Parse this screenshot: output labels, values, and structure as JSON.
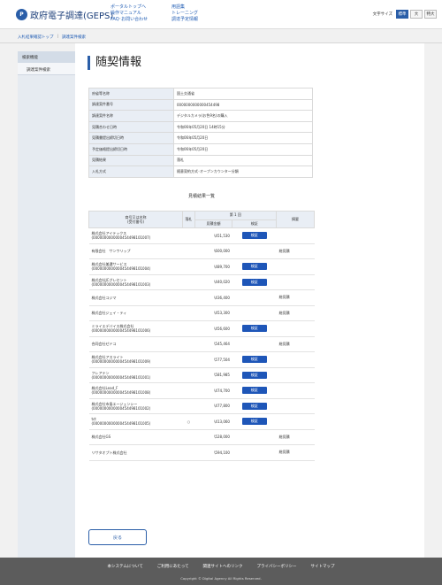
{
  "header": {
    "logo_mark": "P",
    "logo_text": "政府電子調達(GEPS)",
    "nav_col1": [
      "ポータルトップへ",
      "操作マニュアル",
      "FAQ･お問い合わせ"
    ],
    "nav_col2": [
      "用語集",
      "トレーニング",
      "調達予定情報"
    ],
    "fontsize_label": "文字サイズ",
    "fontsize_options": [
      "標準",
      "大",
      "特大"
    ]
  },
  "breadcrumb": [
    "入札結果確認トップ",
    "調達案件検索"
  ],
  "sidebar": {
    "heading": "検索機能",
    "items": [
      "調達案件検索"
    ]
  },
  "page_title": "随契情報",
  "info_rows": [
    {
      "label": "府省等名称",
      "value": "国土交通省"
    },
    {
      "label": "調達案件番号",
      "value": "0000000000000454498"
    },
    {
      "label": "調達案件名称",
      "value": "デジタルカメラ(お色9名)の購入"
    },
    {
      "label": "見積合わせ日時",
      "value": "令和06年05月20日 14時15分"
    },
    {
      "label": "見積書提出締切日時",
      "value": "令和06年05月20日"
    },
    {
      "label": "予定価格提出締切日時",
      "value": "令和06年05月20日"
    },
    {
      "label": "見積結果",
      "value": "落札"
    },
    {
      "label": "入札方式",
      "value": "随意契約方式･オープンカウンター分類"
    }
  ],
  "results_title": "見積結果一覧",
  "results_header": {
    "name": "商号又は名称\n(受付番号)",
    "mark": "落札",
    "round": "第 1 回",
    "amount": "見積金額",
    "check": "検証",
    "note": "摘要"
  },
  "results": [
    {
      "name": "株式会社アイテックス",
      "id": "(0000000000000454498101007)",
      "mark": "",
      "amount": "\\451,530",
      "check": "検証",
      "note": ""
    },
    {
      "name": "有限会社　サンワリップ",
      "id": "",
      "mark": "",
      "amount": "\\600,000",
      "check": "",
      "note": "総見積"
    },
    {
      "name": "株式会社美濃サービス",
      "id": "(0000000000000454498101004)",
      "mark": "",
      "amount": "\\489,700",
      "check": "検証",
      "note": ""
    },
    {
      "name": "株式会社JCグレセント",
      "id": "(0000000000000454498101003)",
      "mark": "",
      "amount": "\\440,020",
      "check": "検証",
      "note": ""
    },
    {
      "name": "株式会社コジマ",
      "id": "",
      "mark": "",
      "amount": "\\436,400",
      "check": "",
      "note": "総見積"
    },
    {
      "name": "株式会社ジェイ・ティ",
      "id": "",
      "mark": "",
      "amount": "\\453,300",
      "check": "",
      "note": "総見積"
    },
    {
      "name": "ミライエデバイス株式会社",
      "id": "(0000000000000454498101006)",
      "mark": "",
      "amount": "\\456,600",
      "check": "検証",
      "note": ""
    },
    {
      "name": "合同会社ゼドコ",
      "id": "",
      "mark": "",
      "amount": "\\545,464",
      "check": "",
      "note": "総見積"
    },
    {
      "name": "株式会社アスライト",
      "id": "(0000000000000454498101009)",
      "mark": "",
      "amount": "\\577,504",
      "check": "検証",
      "note": ""
    },
    {
      "name": "フレアテン",
      "id": "(0000000000000454498101001)",
      "mark": "",
      "amount": "\\581,985",
      "check": "検証",
      "note": ""
    },
    {
      "name": "株式会社Lead_F",
      "id": "(0000000000000454498101008)",
      "mark": "",
      "amount": "\\474,700",
      "check": "検証",
      "note": ""
    },
    {
      "name": "株式会社市島エージェンシー",
      "id": "(0000000000000454498101002)",
      "mark": "",
      "amount": "\\477,800",
      "check": "検証",
      "note": ""
    },
    {
      "name": "tct",
      "id": "(0000000000000454498101005)",
      "mark": "○",
      "amount": "\\413,060",
      "check": "検証",
      "note": ""
    },
    {
      "name": "株式会社GS",
      "id": "",
      "mark": "",
      "amount": "\\528,000",
      "check": "",
      "note": "総見積"
    },
    {
      "name": "リサタオプト株式会社",
      "id": "",
      "mark": "",
      "amount": "\\594,100",
      "check": "",
      "note": "総見積"
    }
  ],
  "back_label": "戻る",
  "footer": {
    "links": [
      "本システムについて",
      "ご利用にあたって",
      "関連サイトへのリンク",
      "プライバシーポリシー",
      "サイトマップ"
    ],
    "copyright": "Copyright © Digital Agency All Rights Reserved."
  }
}
